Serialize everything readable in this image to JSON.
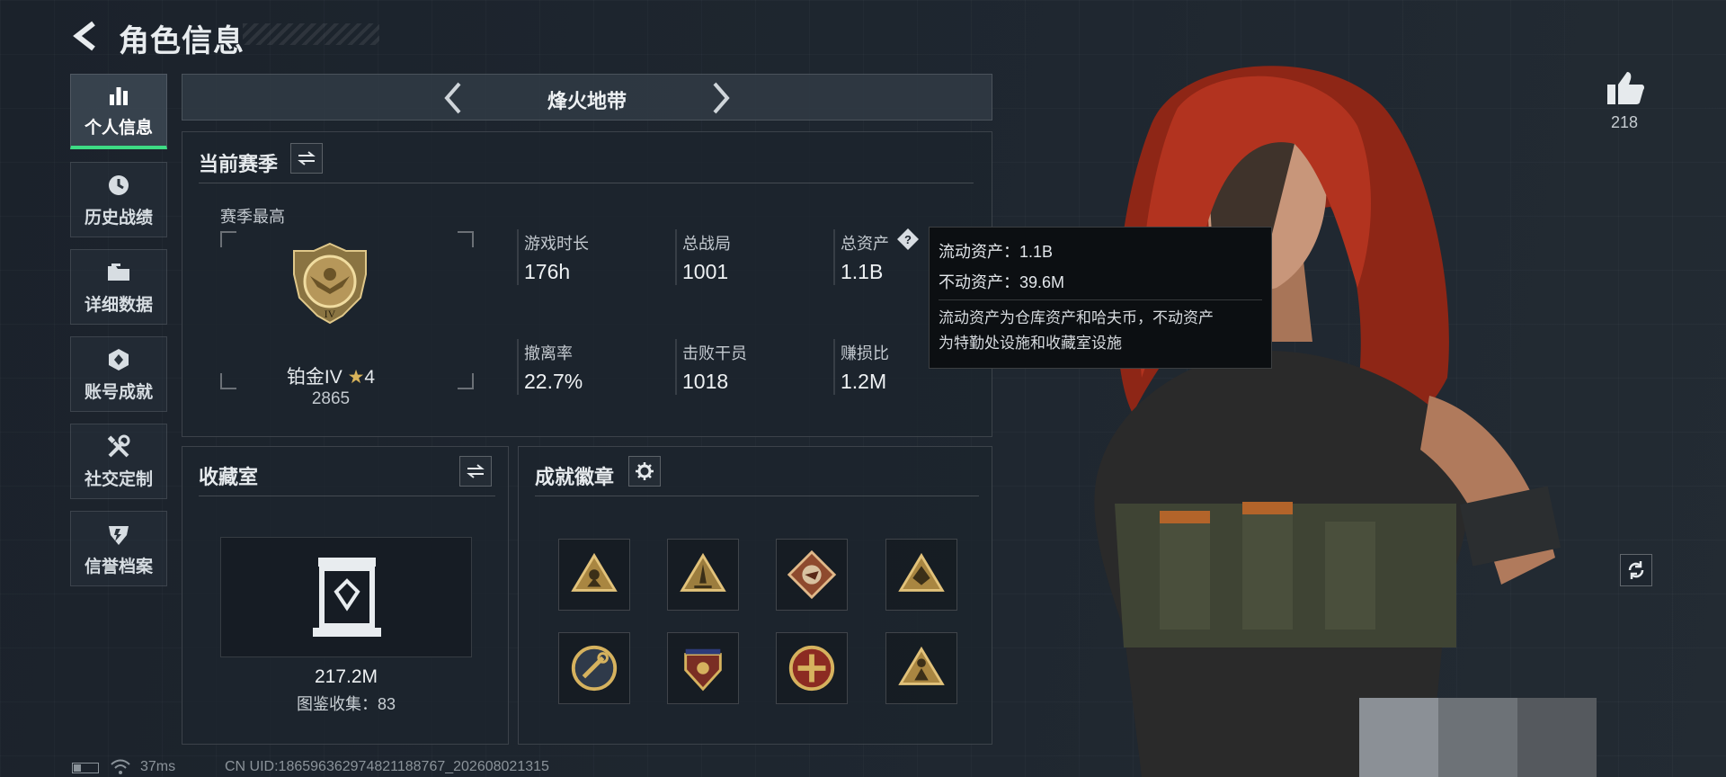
{
  "header": {
    "title": "角色信息"
  },
  "sidebar": {
    "items": [
      {
        "label": "个人信息",
        "icon": "bar-chart-icon",
        "active": true
      },
      {
        "label": "历史战绩",
        "icon": "clock-icon"
      },
      {
        "label": "详细数据",
        "icon": "folder-icon"
      },
      {
        "label": "账号成就",
        "icon": "hexagon-emblem-icon"
      },
      {
        "label": "社交定制",
        "icon": "tools-icon"
      },
      {
        "label": "信誉档案",
        "icon": "shield-icon"
      }
    ]
  },
  "map_selector": {
    "name": "烽火地带"
  },
  "season": {
    "title": "当前赛季",
    "best_label": "赛季最高",
    "rank_name": "铂金IV",
    "rank_stars": "4",
    "rank_score": "2865",
    "rank_numeral": "IV",
    "stats": [
      {
        "label": "游戏时长",
        "value": "176h"
      },
      {
        "label": "总战局",
        "value": "1001"
      },
      {
        "label": "总资产",
        "value": "1.1B"
      },
      {
        "label": "撤离率",
        "value": "22.7%"
      },
      {
        "label": "击败干员",
        "value": "1018"
      },
      {
        "label": "赚损比",
        "value": "1.2M"
      }
    ]
  },
  "tooltip": {
    "liquid": "流动资产：1.1B",
    "fixed": "不动资产：39.6M",
    "desc_line1": "流动资产为仓库资产和哈夫币，不动资产",
    "desc_line2": "为特勤处设施和收藏室设施"
  },
  "collection": {
    "title": "收藏室",
    "value": "217.2M",
    "catalog": "图鉴收集：83"
  },
  "achievements": {
    "title": "成就徽章",
    "badges": [
      "triangle-soldier-icon",
      "triangle-rocket-icon",
      "diamond-beast-icon",
      "triangle-emblem-icon",
      "round-wrench-badge-icon",
      "stars-shield-badge-icon",
      "cross-badge-icon",
      "triangle-figure-icon"
    ]
  },
  "likes": {
    "count": "218"
  },
  "status_bar": {
    "ping": "37ms",
    "uid": "CN UID:18659636297482118876​7_202608021315"
  },
  "colors": {
    "accent": "#3ddc84",
    "gold": "#c9a45a",
    "hair": "#b2331f"
  }
}
